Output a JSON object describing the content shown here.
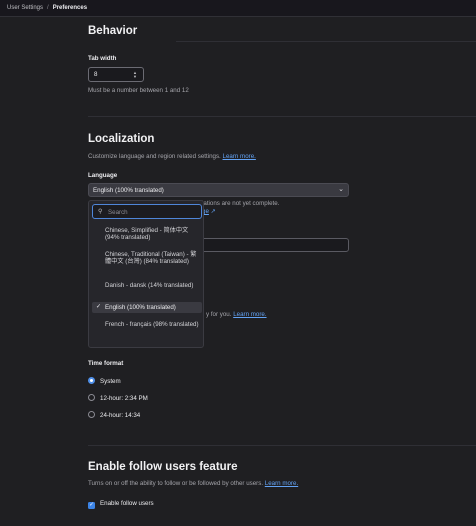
{
  "breadcrumb": {
    "parent": "User Settings",
    "separator": "/",
    "current": "Preferences"
  },
  "behavior": {
    "title": "Behavior",
    "tab_width_label": "Tab width",
    "tab_width_value": "8",
    "tab_width_help": "Must be a number between 1 and 12"
  },
  "localization": {
    "title": "Localization",
    "description": "Customize language and region related settings.",
    "learn_more": "Learn more.",
    "language_label": "Language",
    "language_selected": "English (100% translated)",
    "behind_note": "lations are not yet complete.",
    "behind_link": "ge",
    "behind_note2": "y for you.",
    "behind_link2": "Learn more."
  },
  "language_dropdown": {
    "search_placeholder": "Search",
    "options": [
      {
        "label": "Chinese, Simplified - 简体中文 (94% translated)",
        "selected": false
      },
      {
        "label": "Chinese, Traditional (Taiwan) - 繁體中文 (台灣) (84% translated)",
        "selected": false
      },
      {
        "label": "Danish - dansk (14% translated)",
        "selected": false
      },
      {
        "label": "English (100% translated)",
        "selected": true
      },
      {
        "label": "French - français (98% translated)",
        "selected": false
      }
    ]
  },
  "time_format": {
    "label": "Time format",
    "options": [
      {
        "label": "System",
        "selected": true
      },
      {
        "label": "12-hour: 2:34 PM",
        "selected": false
      },
      {
        "label": "24-hour: 14:34",
        "selected": false
      }
    ]
  },
  "follow": {
    "title": "Enable follow users feature",
    "description": "Turns on or off the ability to follow or be followed by other users.",
    "learn_more": "Learn more.",
    "checkbox_label": "Enable follow users",
    "checked": true
  }
}
